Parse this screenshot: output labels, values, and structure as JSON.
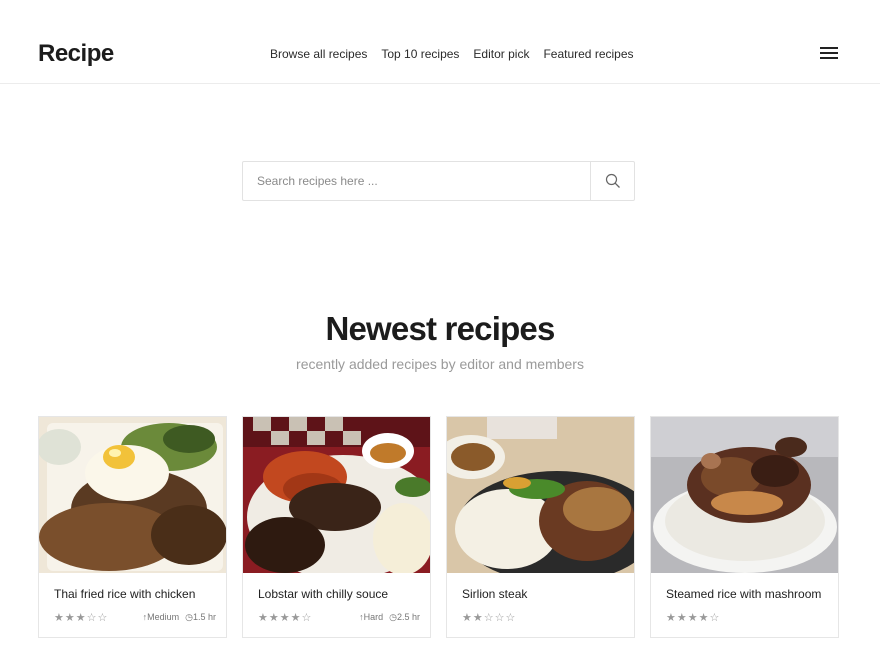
{
  "header": {
    "logo": "Recipe",
    "nav": [
      "Browse all recipes",
      "Top 10 recipes",
      "Editor pick",
      "Featured recipes"
    ],
    "menu_icon": "hamburger-menu-icon"
  },
  "search": {
    "placeholder": "Search recipes here ...",
    "value": "",
    "icon": "search-icon"
  },
  "section": {
    "title": "Newest recipes",
    "subtitle": "recently added recipes by editor and members"
  },
  "cards": [
    {
      "title": "Thai fried rice with chicken",
      "rating": 3,
      "rating_max": 5,
      "difficulty": "Medium",
      "time": "1.5 hr"
    },
    {
      "title": "Lobstar with chilly souce",
      "rating": 4,
      "rating_max": 5,
      "difficulty": "Hard",
      "time": "2.5 hr"
    },
    {
      "title": "Sirlion steak",
      "rating": 2,
      "rating_max": 5,
      "difficulty": "",
      "time": ""
    },
    {
      "title": "Steamed rice with mashroom",
      "rating": 4,
      "rating_max": 5,
      "difficulty": "",
      "time": ""
    }
  ],
  "colors": {
    "text": "#222222",
    "muted": "#9a9a9a",
    "border": "#e6e6e6"
  }
}
